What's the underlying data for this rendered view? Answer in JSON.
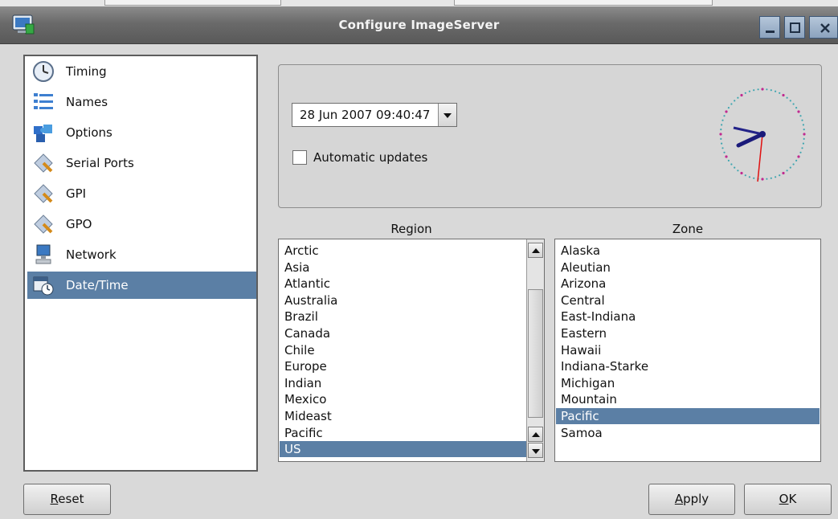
{
  "window": {
    "title": "Configure ImageServer"
  },
  "nav": {
    "items": [
      {
        "label": "Timing",
        "icon": "clock-icon"
      },
      {
        "label": "Names",
        "icon": "list-icon"
      },
      {
        "label": "Options",
        "icon": "puzzle-icon"
      },
      {
        "label": "Serial Ports",
        "icon": "plug-icon"
      },
      {
        "label": "GPI",
        "icon": "plug-icon"
      },
      {
        "label": "GPO",
        "icon": "plug-icon"
      },
      {
        "label": "Network",
        "icon": "computer-icon"
      },
      {
        "label": "Date/Time",
        "icon": "calendar-clock-icon"
      }
    ],
    "selected": "Date/Time"
  },
  "datetime": {
    "value": "28 Jun 2007 09:40:47",
    "auto_updates_label": "Automatic updates",
    "auto_updates_checked": false
  },
  "region": {
    "header": "Region",
    "items": [
      "Arctic",
      "Asia",
      "Atlantic",
      "Australia",
      "Brazil",
      "Canada",
      "Chile",
      "Europe",
      "Indian",
      "Mexico",
      "Mideast",
      "Pacific",
      "US"
    ],
    "selected": "US"
  },
  "zone": {
    "header": "Zone",
    "items": [
      "Alaska",
      "Aleutian",
      "Arizona",
      "Central",
      "East-Indiana",
      "Eastern",
      "Hawaii",
      "Indiana-Starke",
      "Michigan",
      "Mountain",
      "Pacific",
      "Samoa"
    ],
    "selected": "Pacific"
  },
  "buttons": {
    "reset": {
      "mnemonic": "R",
      "rest": "eset"
    },
    "apply": {
      "mnemonic": "A",
      "rest": "pply"
    },
    "ok": {
      "mnemonic": "O",
      "rest": "K"
    }
  },
  "colors": {
    "selection": "#5b7fa5",
    "titlebar": "#6a6a6a"
  }
}
